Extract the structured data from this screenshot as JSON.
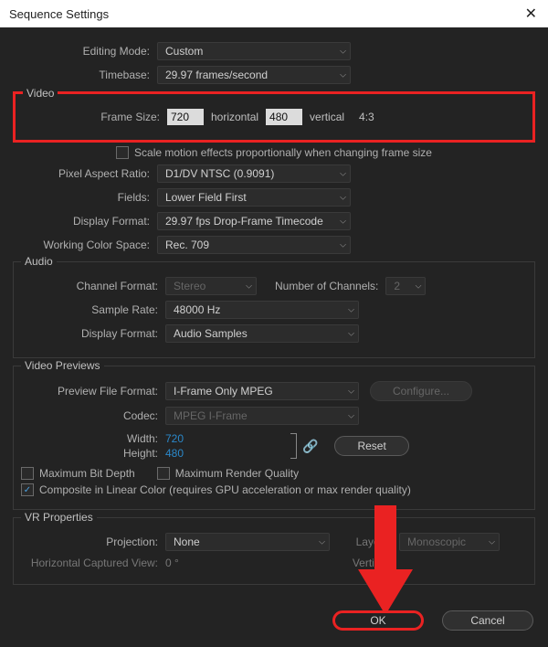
{
  "window": {
    "title": "Sequence Settings"
  },
  "editing_mode": {
    "label": "Editing Mode:",
    "value": "Custom"
  },
  "timebase": {
    "label": "Timebase:",
    "value": "29.97 frames/second"
  },
  "video": {
    "legend": "Video",
    "frame_size_label": "Frame Size:",
    "width": "720",
    "horizontal": "horizontal",
    "height": "480",
    "vertical": "vertical",
    "aspect": "4:3",
    "scale_checkbox": "Scale motion effects proportionally when changing frame size",
    "par_label": "Pixel Aspect Ratio:",
    "par_value": "D1/DV NTSC (0.9091)",
    "fields_label": "Fields:",
    "fields_value": "Lower Field First",
    "display_format_label": "Display Format:",
    "display_format_value": "29.97 fps Drop-Frame Timecode",
    "wcs_label": "Working Color Space:",
    "wcs_value": "Rec. 709"
  },
  "audio": {
    "legend": "Audio",
    "channel_format_label": "Channel Format:",
    "channel_format_value": "Stereo",
    "num_channels_label": "Number of Channels:",
    "num_channels_value": "2",
    "sample_rate_label": "Sample Rate:",
    "sample_rate_value": "48000 Hz",
    "display_format_label": "Display Format:",
    "display_format_value": "Audio Samples"
  },
  "previews": {
    "legend": "Video Previews",
    "pff_label": "Preview File Format:",
    "pff_value": "I-Frame Only MPEG",
    "configure": "Configure...",
    "codec_label": "Codec:",
    "codec_value": "MPEG I-Frame",
    "width_label": "Width:",
    "width_value": "720",
    "height_label": "Height:",
    "height_value": "480",
    "reset": "Reset",
    "max_bit_depth": "Maximum Bit Depth",
    "max_render_quality": "Maximum Render Quality",
    "composite": "Composite in Linear Color (requires GPU acceleration or max render quality)"
  },
  "vr": {
    "legend": "VR Properties",
    "projection_label": "Projection:",
    "projection_value": "None",
    "layout_label": "Layout:",
    "layout_value": "Monoscopic",
    "hcv_label": "Horizontal Captured View:",
    "hcv_value": "0 °",
    "vertical_label": "Vertical:"
  },
  "footer": {
    "ok": "OK",
    "cancel": "Cancel"
  }
}
